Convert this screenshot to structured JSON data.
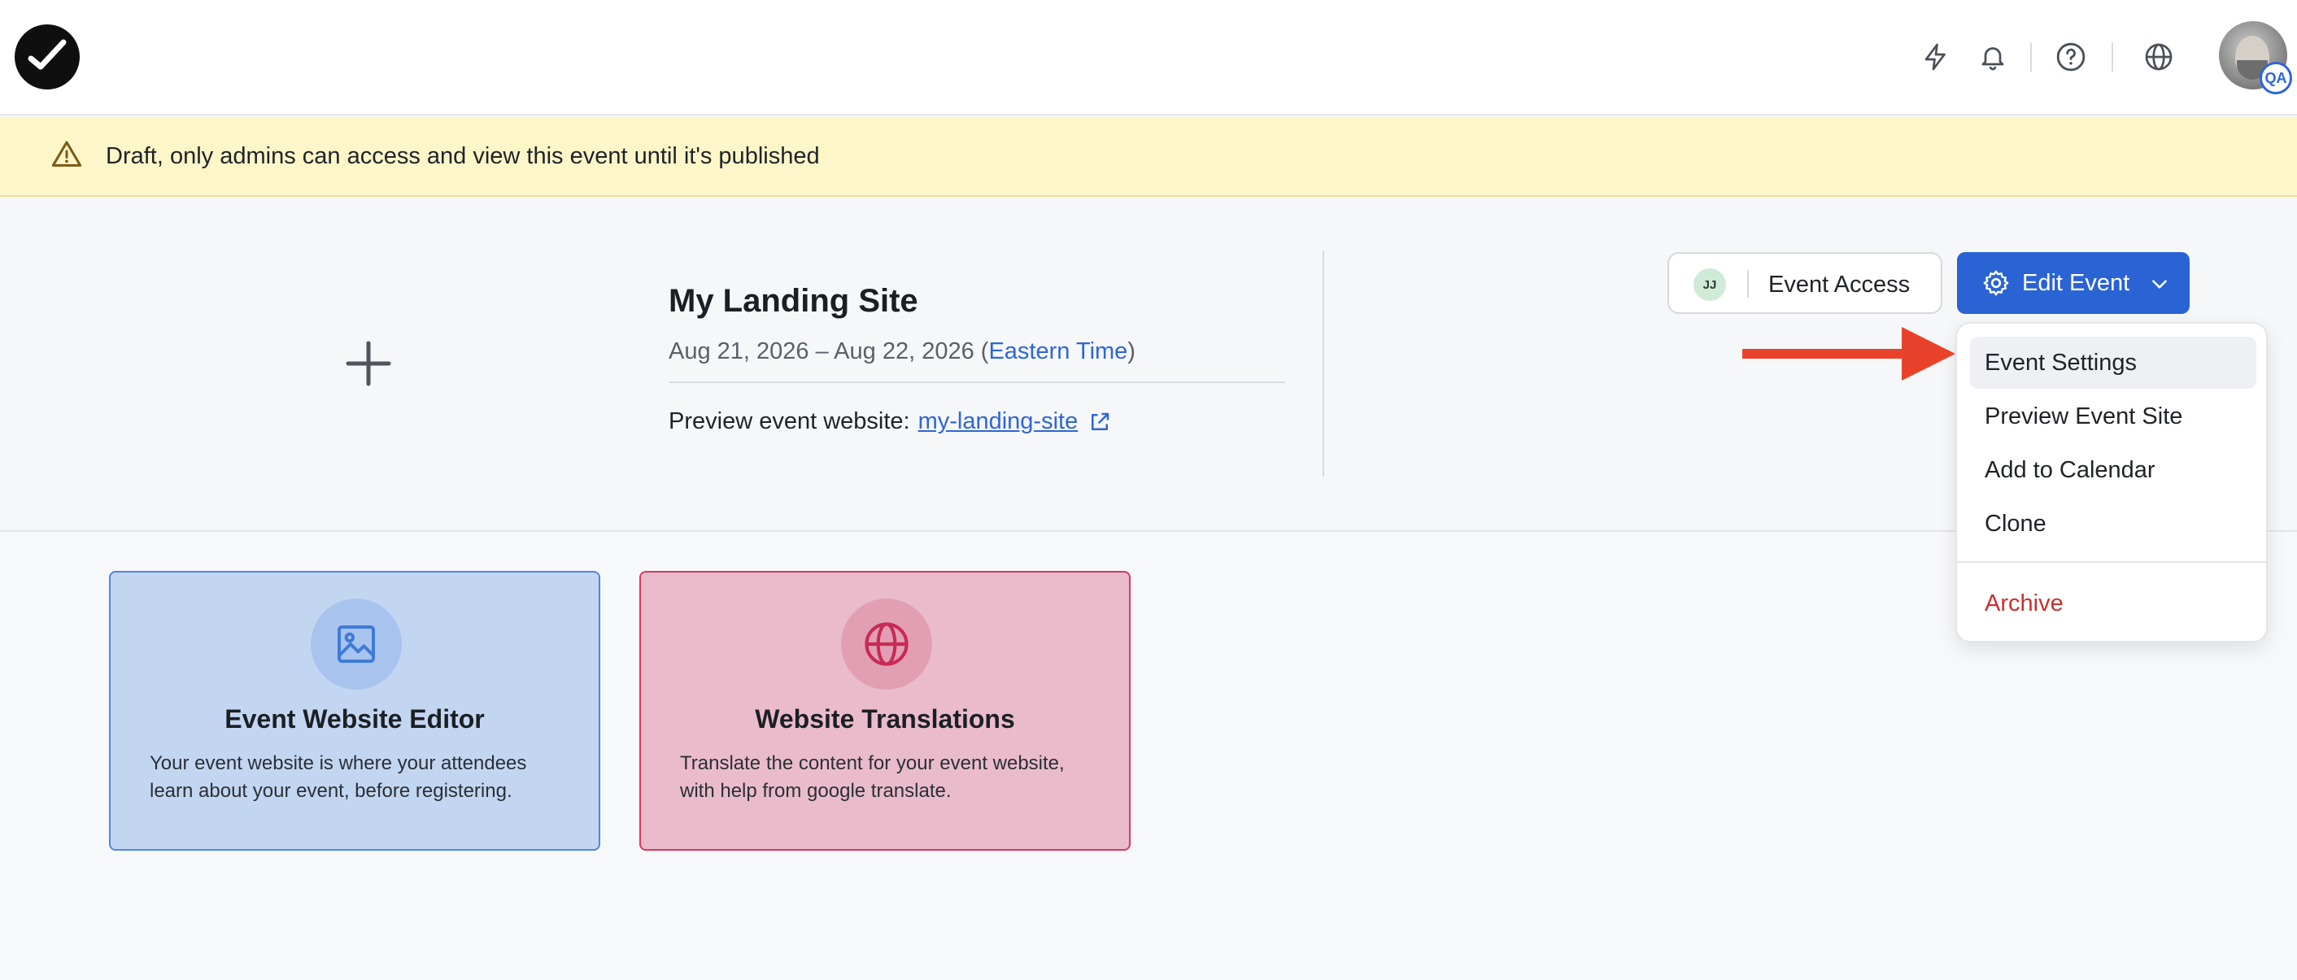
{
  "topbar": {
    "logo": "checkmark-logo",
    "icons": [
      "lightning-icon",
      "bell-icon",
      "help-icon",
      "globe-icon"
    ],
    "avatar_badge": "QA"
  },
  "banner": {
    "icon": "warning-icon",
    "text": "Draft, only admins can access and view this event until it's published"
  },
  "event": {
    "title": "My Landing Site",
    "date_range": "Aug 21, 2026 – Aug 22, 2026 (",
    "timezone": "Eastern Time",
    "date_close": ")",
    "preview_label": "Preview event website:",
    "preview_link": "my-landing-site"
  },
  "actions": {
    "access_initials": "JJ",
    "access_label": "Event Access",
    "edit_label": "Edit Event"
  },
  "dropdown": {
    "items": [
      "Event Settings",
      "Preview Event Site",
      "Add to Calendar",
      "Clone"
    ],
    "danger_item": "Archive"
  },
  "cards": [
    {
      "title": "Event Website Editor",
      "description": "Your event website is where your attendees learn about your event, before registering.",
      "icon": "image-icon"
    },
    {
      "title": "Website Translations",
      "description": "Translate the content for your event website, with help from google translate.",
      "icon": "globe-icon"
    }
  ],
  "colors": {
    "primary": "#2a63d4",
    "banner_bg": "#fdf6c8",
    "danger": "#c8302e",
    "arrow": "#e8432a"
  }
}
